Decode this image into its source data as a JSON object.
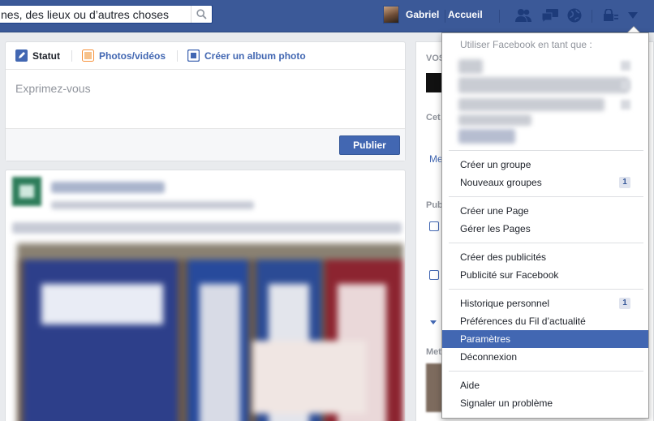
{
  "topbar": {
    "search_value": "nes, des lieux ou d’autres choses",
    "user_name": "Gabriel",
    "home_label": "Accueil",
    "icons": [
      "friends-icon",
      "messages-icon",
      "notifications-icon",
      "privacy-icon",
      "account-menu-icon"
    ]
  },
  "composer": {
    "tabs": [
      {
        "label": "Statut"
      },
      {
        "label": "Photos/vidéos"
      },
      {
        "label": "Créer un album photo"
      }
    ],
    "placeholder": "Exprimez-vous",
    "publish_label": "Publier"
  },
  "rightcol": {
    "labels": [
      "VOS",
      "Cet",
      "Me",
      "Publ",
      "Met"
    ]
  },
  "menu": {
    "header": "Utiliser Facebook en tant que :",
    "groups": [
      {
        "items": [
          {
            "label": "Créer un groupe"
          },
          {
            "label": "Nouveaux groupes",
            "badge": "1"
          }
        ]
      },
      {
        "items": [
          {
            "label": "Créer une Page"
          },
          {
            "label": "Gérer les Pages"
          }
        ]
      },
      {
        "items": [
          {
            "label": "Créer des publicités"
          },
          {
            "label": "Publicité sur Facebook"
          }
        ]
      },
      {
        "items": [
          {
            "label": "Historique personnel",
            "badge": "1"
          },
          {
            "label": "Préférences du Fil d’actualité"
          },
          {
            "label": "Paramètres",
            "active": true
          },
          {
            "label": "Déconnexion"
          }
        ]
      },
      {
        "items": [
          {
            "label": "Aide"
          },
          {
            "label": "Signaler un problème"
          }
        ]
      }
    ]
  },
  "colors": {
    "brand": "#3b5998",
    "link": "#4267b2",
    "highlight": "#4267b2"
  }
}
